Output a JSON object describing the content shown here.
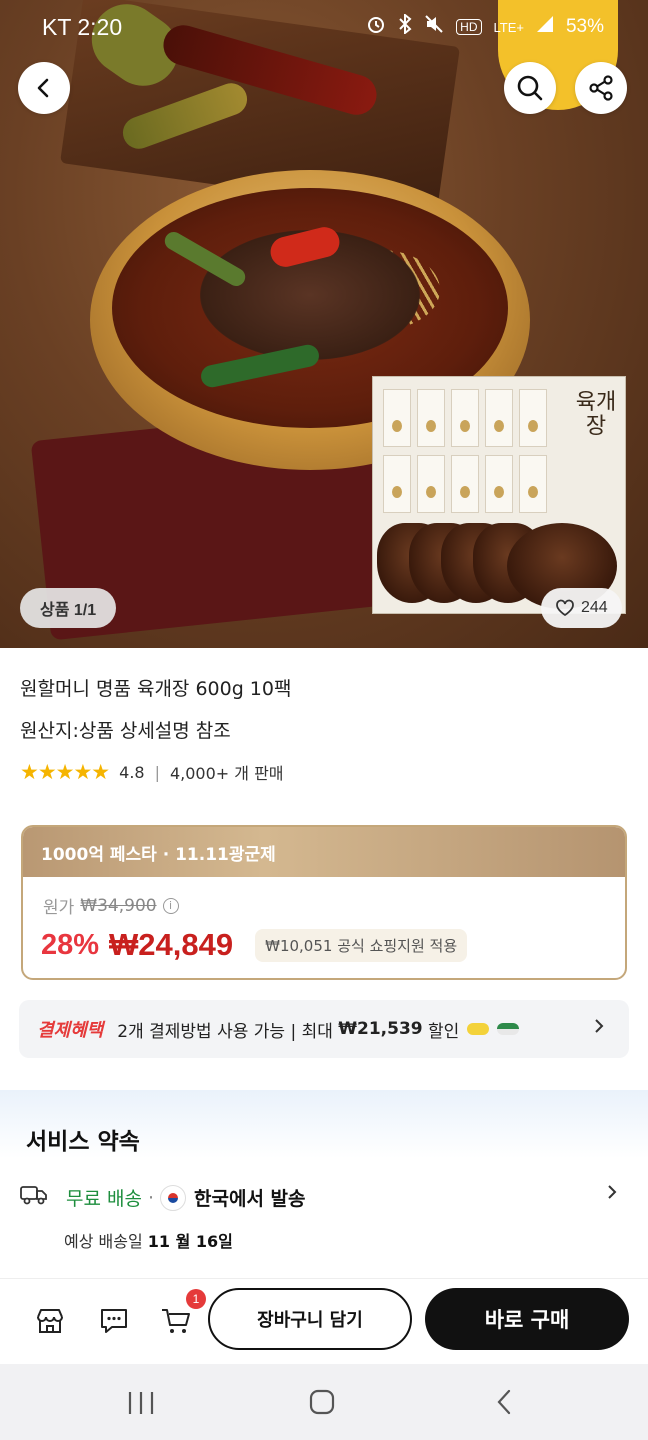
{
  "status_bar": {
    "carrier_time": "KT 2:20",
    "network": "LTE+",
    "battery": "53%"
  },
  "hero": {
    "image_counter": "상품 1/1",
    "like_count": "244",
    "box_title": "육개장"
  },
  "product": {
    "title": "원할머니 명품 육개장 600g 10팩",
    "origin": "원산지:상품 상세설명 참조",
    "stars": "★★★★★",
    "rating": "4.8",
    "sales": "4,000+ 개 판매"
  },
  "price_card": {
    "banner": "1000억 페스타 · 11.11광군제",
    "original_label": "원가",
    "original_price": "₩34,900",
    "info_glyph": "i",
    "discount": "28%",
    "price": "₩24,849",
    "support_text": "₩10,051 공식 쇼핑지원 적용"
  },
  "payment": {
    "label": "결제혜택",
    "text_prefix": "2개 결제방법 사용 가능 | 최대 ",
    "max_amount": "₩21,539",
    "text_suffix": " 할인"
  },
  "service": {
    "heading": "서비스 약속",
    "free_shipping": "무료 배송",
    "dot": "·",
    "ship_from": "한국에서 발송",
    "eta_label": "예상 배송일 ",
    "eta_date": "11 월 16일"
  },
  "action_bar": {
    "cart_badge": "1",
    "add_to_cart": "장바구니 담기",
    "buy_now": "바로 구매"
  },
  "colors": {
    "discount_red": "#e8363f",
    "price_red": "#c8201e",
    "banner_gold": "#c4a77a",
    "free_green": "#1e8e3e",
    "buy_black": "#111111"
  }
}
